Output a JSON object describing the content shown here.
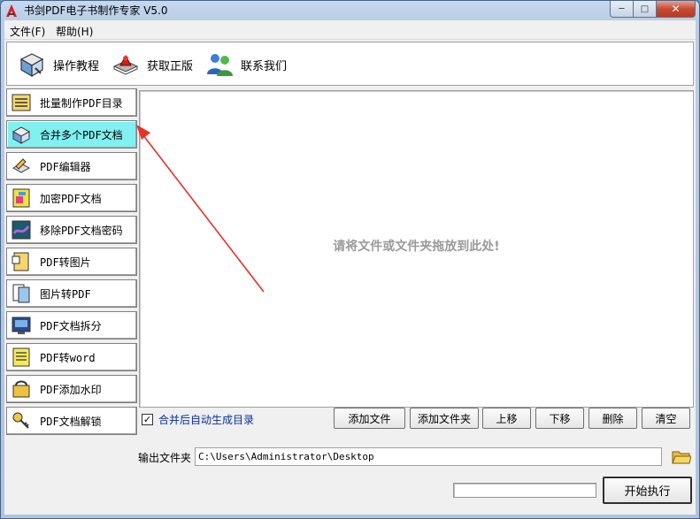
{
  "window": {
    "title": "书剑PDF电子书制作专家 V5.0",
    "min_glyph": "─",
    "max_glyph": "□",
    "close_glyph": "✕"
  },
  "menu": [
    {
      "label": "文件(F)"
    },
    {
      "label": "帮助(H)"
    }
  ],
  "toolbar": [
    {
      "label": "操作教程",
      "icon": "book-icon"
    },
    {
      "label": "获取正版",
      "icon": "genuine-key-icon"
    },
    {
      "label": "联系我们",
      "icon": "contact-users-icon"
    }
  ],
  "sidebar": {
    "active_index": 1,
    "items": [
      {
        "label": "批量制作PDF目录",
        "icon": "list-folder-icon"
      },
      {
        "label": "合并多个PDF文档",
        "icon": "merge-docs-icon"
      },
      {
        "label": "PDF编辑器",
        "icon": "editor-icon"
      },
      {
        "label": "加密PDF文档",
        "icon": "encrypt-icon"
      },
      {
        "label": "移除PDF文档密码",
        "icon": "remove-password-icon"
      },
      {
        "label": "PDF转图片",
        "icon": "to-image-icon"
      },
      {
        "label": "图片转PDF",
        "icon": "image-to-pdf-icon"
      },
      {
        "label": "PDF文档拆分",
        "icon": "split-icon"
      },
      {
        "label": "PDF转word",
        "icon": "to-word-icon"
      },
      {
        "label": "PDF添加水印",
        "icon": "watermark-icon"
      },
      {
        "label": "PDF文档解锁",
        "icon": "unlock-icon"
      }
    ]
  },
  "dropzone": {
    "hint": "请将文件或文件夹拖放到此处!"
  },
  "options": {
    "auto_toc_label": "合并后自动生成目录",
    "auto_toc_checked": true,
    "check_glyph": "✓"
  },
  "actions": {
    "add_file": "添加文件",
    "add_folder": "添加文件夹",
    "move_up": "上移",
    "move_down": "下移",
    "delete": "删除",
    "clear": "清空"
  },
  "output": {
    "label": "输出文件夹",
    "path": "C:\\Users\\Administrator\\Desktop"
  },
  "progress": {
    "value": 0
  },
  "start_button": "开始执行",
  "colors": {
    "active_sidebar": "#80f0f0",
    "arrow": "#e8302a",
    "link_text": "#0a2fa0"
  }
}
